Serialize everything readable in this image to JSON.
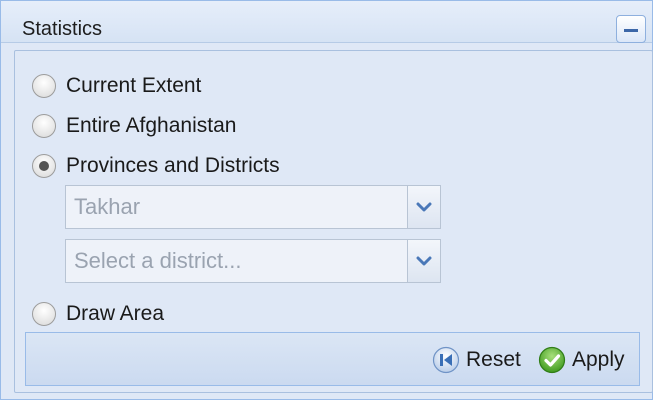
{
  "panel": {
    "title": "Statistics",
    "collapse_icon": "minus-icon"
  },
  "options": [
    {
      "label": "Current Extent",
      "checked": false
    },
    {
      "label": "Entire Afghanistan",
      "checked": false
    },
    {
      "label": "Provinces and Districts",
      "checked": true
    },
    {
      "label": "Draw Area",
      "checked": false
    }
  ],
  "province_select": {
    "value": "Takhar",
    "icon": "chevron-down-icon"
  },
  "district_select": {
    "placeholder": "Select a district...",
    "icon": "chevron-down-icon"
  },
  "toolbar": {
    "reset_label": "Reset",
    "reset_icon": "reset-icon",
    "apply_label": "Apply",
    "apply_icon": "check-icon"
  },
  "colors": {
    "panel_background": "#dfe8f6",
    "panel_border": "#99bbe8",
    "apply_green": "#4caf2a",
    "reset_blue": "#3a6fb6"
  }
}
